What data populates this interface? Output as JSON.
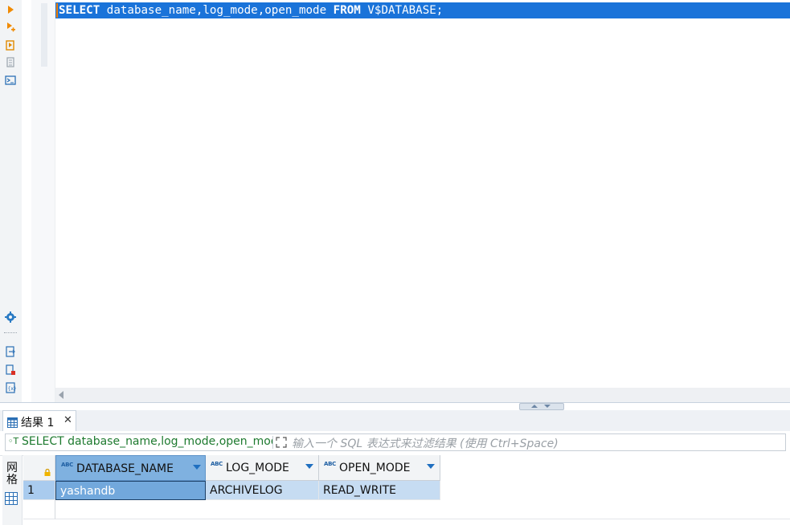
{
  "editor": {
    "sql_line": {
      "kw1": "SELECT",
      "part1": " database_name,log_mode,open_mode ",
      "kw2": "FROM",
      "part2": " V$DATABASE;"
    }
  },
  "left_toolbar": {
    "buttons": [
      "run-statement-icon",
      "run-script-icon",
      "explain-plan-icon",
      "load-execution-plan-icon",
      "terminal-icon",
      "settings-icon",
      "export-icon",
      "import-icon",
      "variables-icon"
    ]
  },
  "results": {
    "tab_label": "结果 1",
    "tab_close": "✕",
    "filter": {
      "query_icon": "◦T",
      "query_text": "SELECT database_name,log_mode,open_mode FROM V$DATABASE",
      "placeholder": "输入一个 SQL 表达式来过滤结果 (使用 Ctrl+Space)"
    },
    "side_label": "网格",
    "columns": [
      {
        "type_badge": "ABC",
        "name": "DATABASE_NAME"
      },
      {
        "type_badge": "ABC",
        "name": "LOG_MODE"
      },
      {
        "type_badge": "ABC",
        "name": "OPEN_MODE"
      }
    ],
    "rows": [
      {
        "num": "1",
        "cells": [
          "yashandb",
          "ARCHIVELOG",
          "READ_WRITE"
        ]
      }
    ]
  },
  "colors": {
    "selection_blue": "#1a73d9",
    "header_selected": "#7fb1e0",
    "filter_green": "#1e7a2f"
  }
}
